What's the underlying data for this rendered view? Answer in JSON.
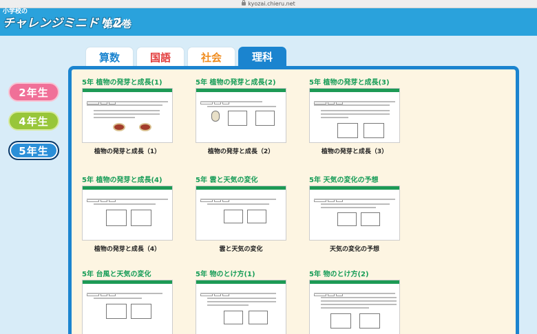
{
  "browser": {
    "url": "kyozai.chieru.net"
  },
  "header": {
    "logo_top": "小学校の",
    "logo_main": "チャレンジミニドリル",
    "volume_prefix": "第",
    "volume_number": "2",
    "volume_suffix": "巻"
  },
  "tabs": [
    {
      "label": "算数",
      "color": "#1b84cf"
    },
    {
      "label": "国語",
      "color": "#e23a3a"
    },
    {
      "label": "社会",
      "color": "#f08c1e"
    },
    {
      "label": "理科",
      "color": "#ffffff",
      "active": true
    }
  ],
  "grades": [
    {
      "label": "2年生"
    },
    {
      "label": "4年生"
    },
    {
      "label": "5年生",
      "active": true
    }
  ],
  "cards": [
    {
      "title": "5年  植物の発芽と成長(1)",
      "caption": "植物の発芽と成長（1）"
    },
    {
      "title": "5年  植物の発芽と成長(2)",
      "caption": "植物の発芽と成長（2）"
    },
    {
      "title": "5年  植物の発芽と成長(3)",
      "caption": "植物の発芽と成長（3）"
    },
    {
      "title": "5年  植物の発芽と成長(4)",
      "caption": "植物の発芽と成長（4）"
    },
    {
      "title": "5年 雲と天気の変化",
      "caption": "雲と天気の変化"
    },
    {
      "title": "5年 天気の変化の予想",
      "caption": "天気の変化の予想"
    },
    {
      "title": "5年 台風と天気の変化",
      "caption": ""
    },
    {
      "title": "5年 物のとけ方(1)",
      "caption": ""
    },
    {
      "title": "5年 物のとけ方(2)",
      "caption": ""
    }
  ]
}
